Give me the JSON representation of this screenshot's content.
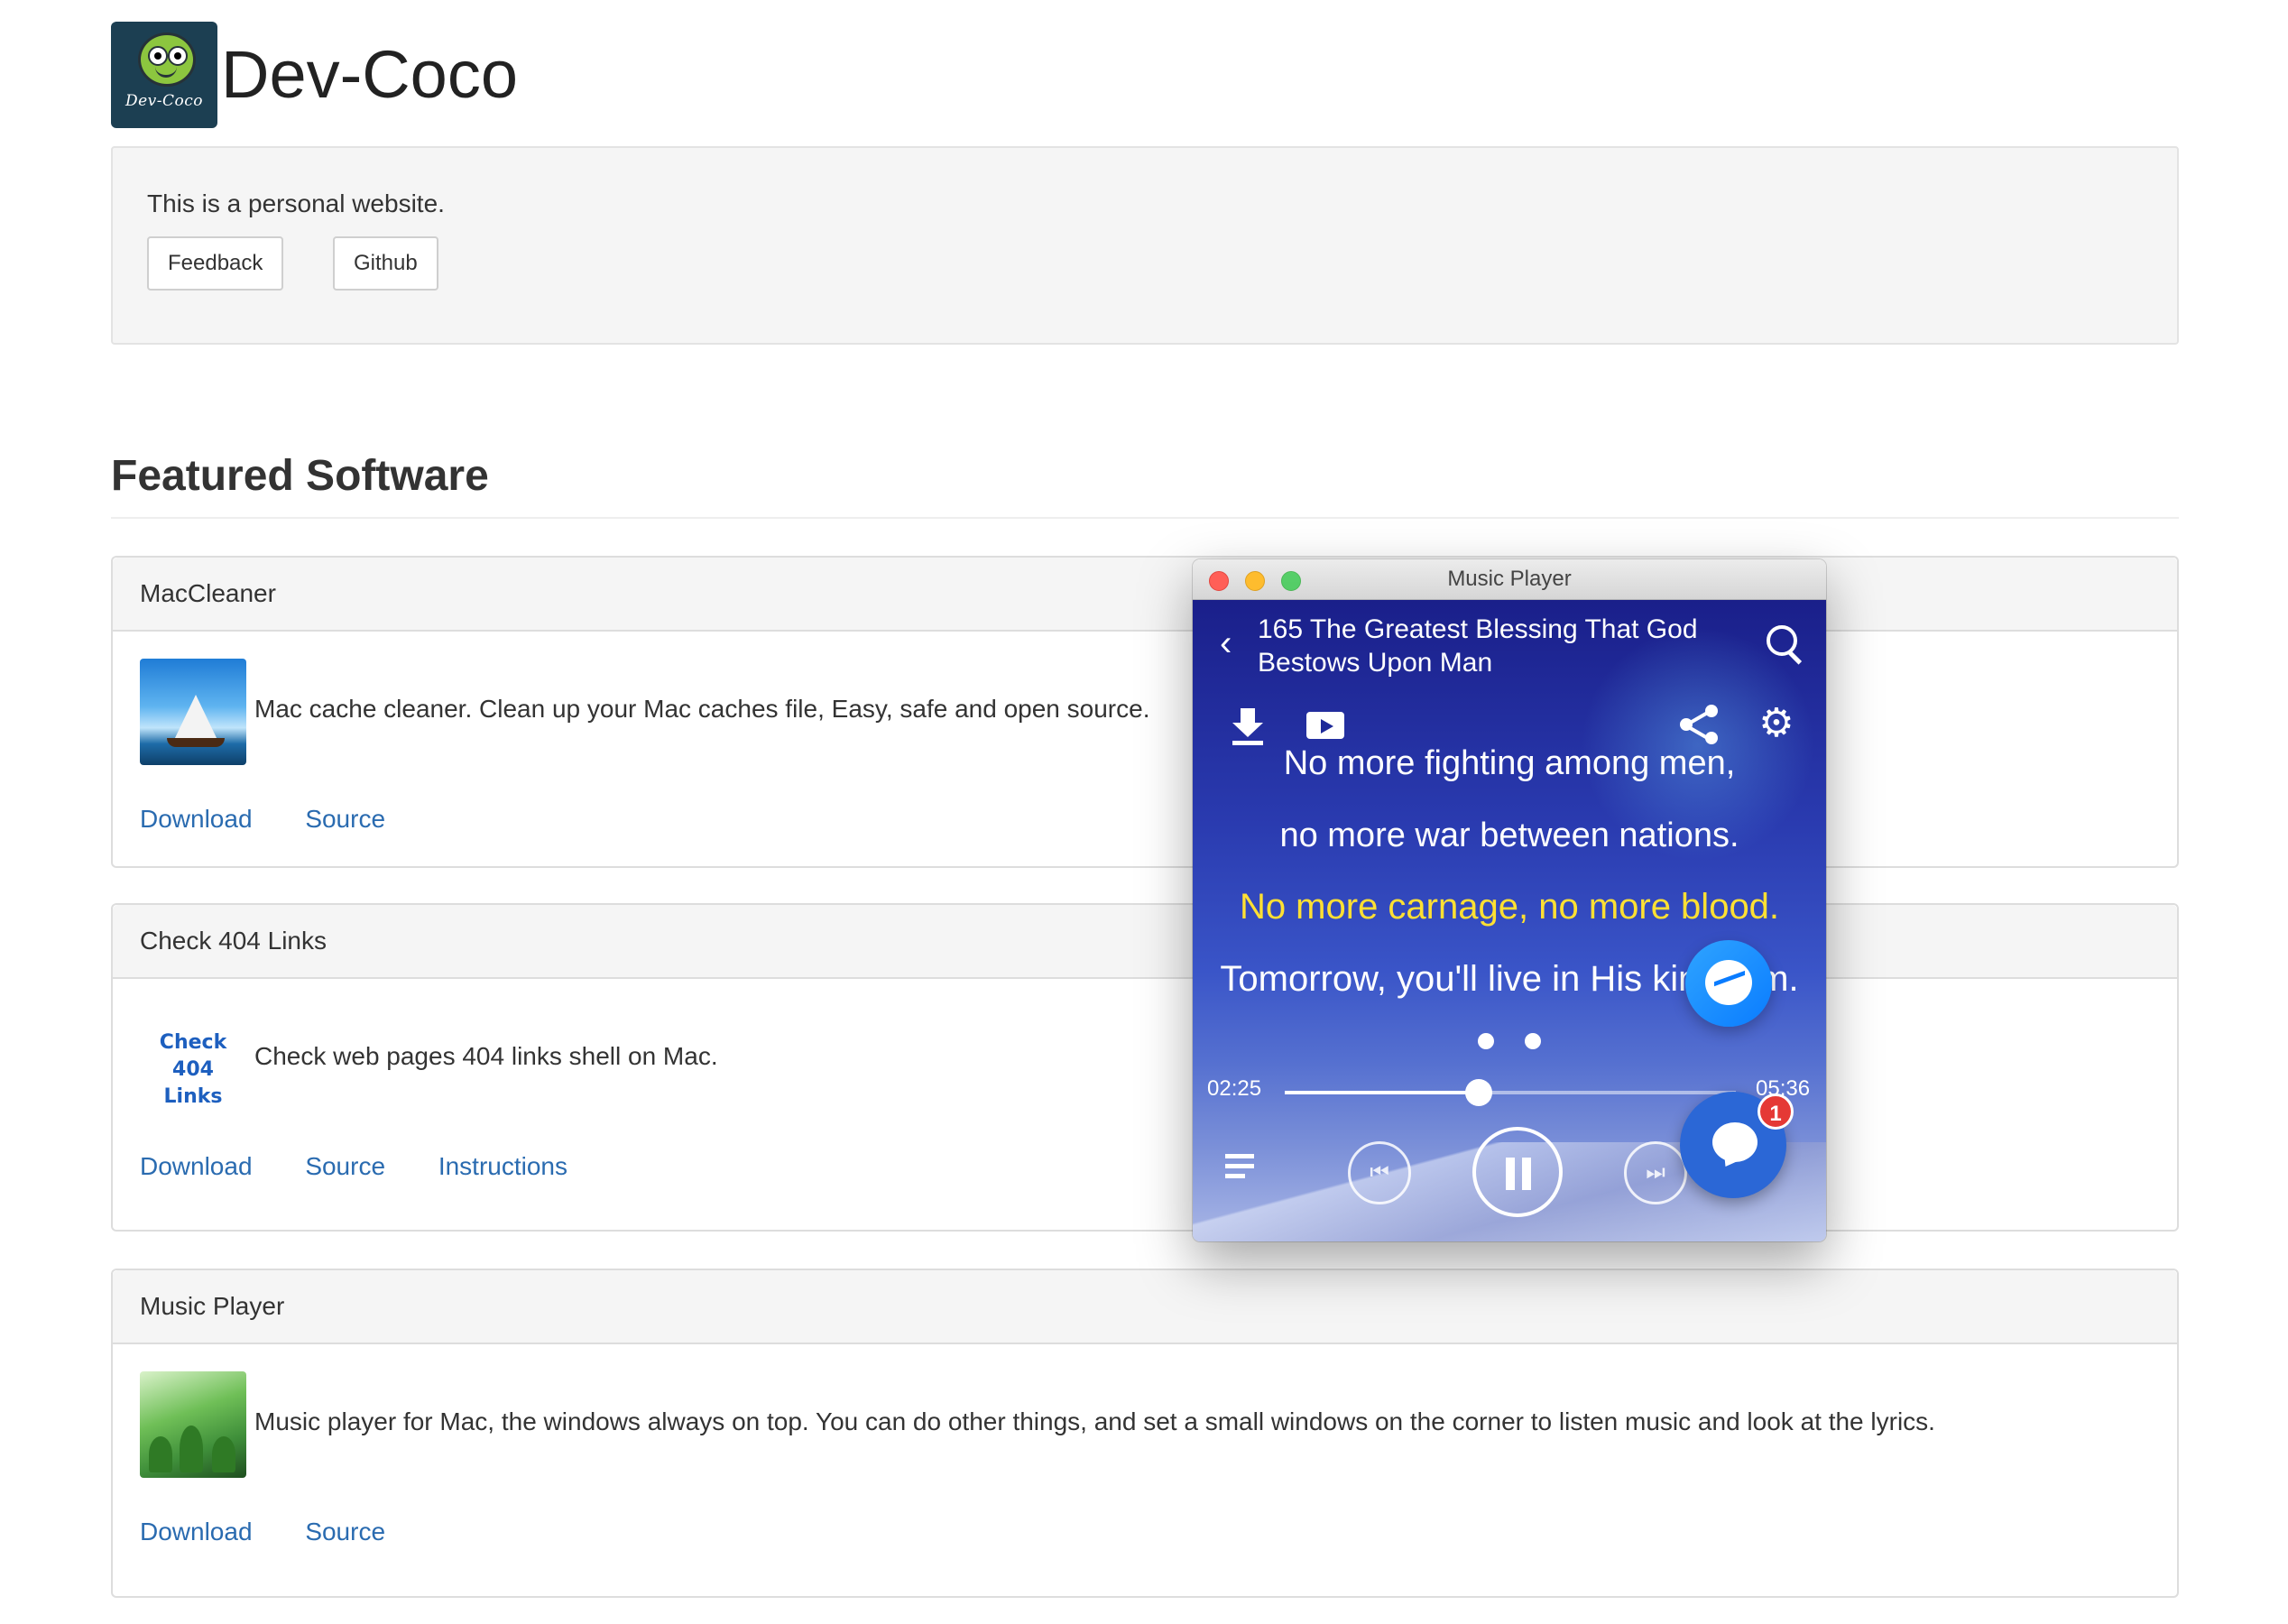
{
  "site": {
    "logo_text": "Dev-Coco",
    "title": "Dev-Coco",
    "intro": "This is a personal website.",
    "buttons": {
      "feedback": "Feedback",
      "github": "Github"
    }
  },
  "featured": {
    "title": "Featured Software",
    "panels": [
      {
        "name": "MacCleaner",
        "description": "Mac cache cleaner. Clean up your Mac caches file, Easy, safe and open source.",
        "links": [
          "Download",
          "Source"
        ]
      },
      {
        "name": "Check 404 Links",
        "thumb_text": [
          "Check",
          "404 Links"
        ],
        "description": "Check web pages 404 links shell on Mac.",
        "links": [
          "Download",
          "Source",
          "Instructions"
        ]
      },
      {
        "name": "Music Player",
        "description": "Music player for Mac, the windows always on top. You can do other things, and set a small windows on the corner to listen music and look at the lyrics.",
        "links": [
          "Download",
          "Source"
        ]
      }
    ]
  },
  "music_player_window": {
    "title": "Music Player",
    "song_title": "165 The Greatest Blessing That God Bestows Upon Man",
    "lyrics": [
      "No more fighting among men,",
      "no more war between nations.",
      "No more carnage, no more blood.",
      "Tomorrow, you'll live in His kingdom."
    ],
    "elapsed": "02:25",
    "total": "05:36",
    "progress_fraction": 0.43,
    "highlight_color": "#ffe033",
    "icons": [
      "back-icon",
      "search-icon",
      "download-icon",
      "video-icon",
      "share-icon",
      "gear-icon",
      "playlist-icon",
      "previous-icon",
      "pause-icon",
      "next-icon"
    ]
  },
  "chat_widgets": {
    "unread_count": "1"
  }
}
